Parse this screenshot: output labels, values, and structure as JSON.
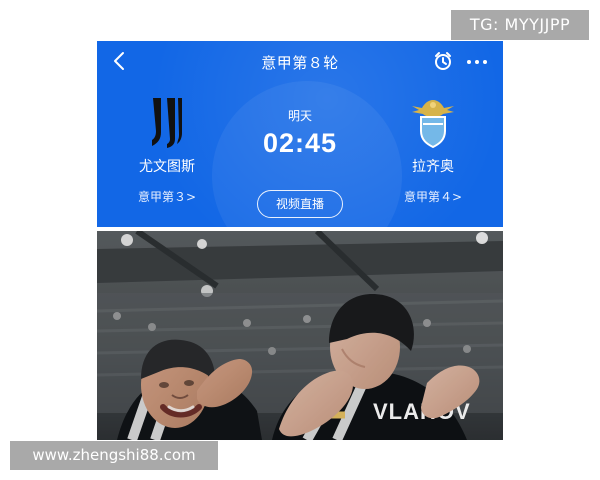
{
  "watermark_top": "TG: MYYJJPP",
  "watermark_bottom": "www.zhengshi88.com",
  "app": {
    "round_title": "意甲第８轮",
    "home": {
      "name": "尤文图斯",
      "rank": "意甲第３>"
    },
    "away": {
      "name": "拉齐奥",
      "rank": "意甲第４>"
    },
    "match_day": "明天",
    "match_time": "02:45",
    "live_button": "视频直播",
    "icons": [
      "back-icon",
      "alarm-clock-icon",
      "more-icon"
    ],
    "colors": {
      "card_bg": "#1267e6",
      "lazio_blue": "#74b8e8",
      "eagle_gold": "#d6b34a"
    }
  },
  "photo": {
    "jersey_text": "VLAHOV"
  }
}
